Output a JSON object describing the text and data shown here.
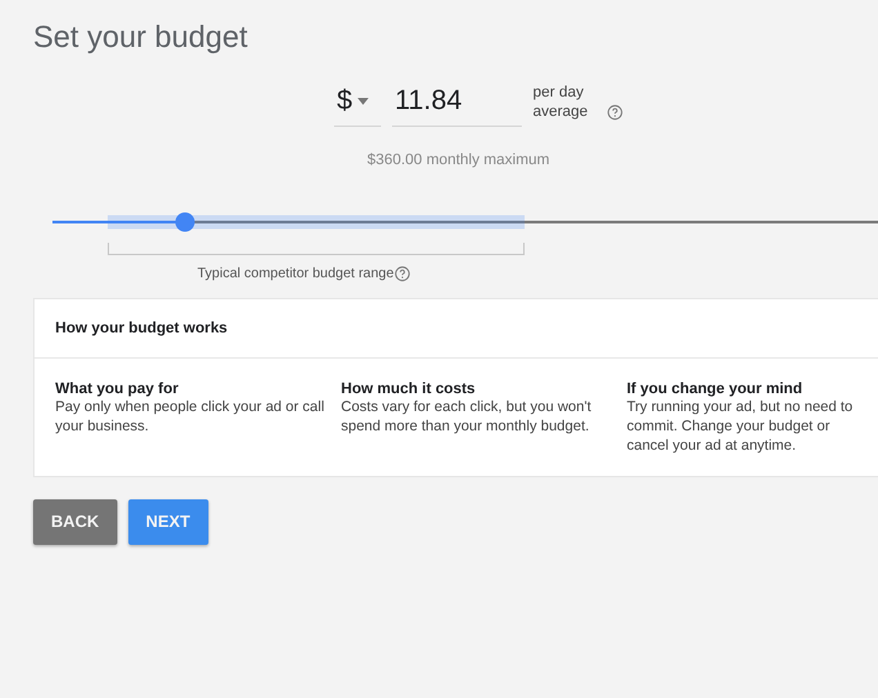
{
  "title": "Set your budget",
  "budget": {
    "currency": "$",
    "amount": "11.84",
    "unit": "per day average",
    "monthly": "$360.00 monthly maximum"
  },
  "slider": {
    "level": 0.16,
    "range_label": "Typical competitor budget range"
  },
  "info_card": {
    "heading": "How your budget works",
    "columns": [
      {
        "title": "What you pay for",
        "text": "Pay only when people click your ad or call your business."
      },
      {
        "title": "How much it costs",
        "text": "Costs vary for each click, but you won't spend more than your monthly budget."
      },
      {
        "title": "If you change your mind",
        "text": "Try running your ad, but no need to commit. Change your budget or cancel your ad at anytime."
      }
    ]
  },
  "buttons": [
    {
      "label": "BACK",
      "kind": "secondary"
    },
    {
      "label": "NEXT",
      "kind": "primary"
    }
  ]
}
